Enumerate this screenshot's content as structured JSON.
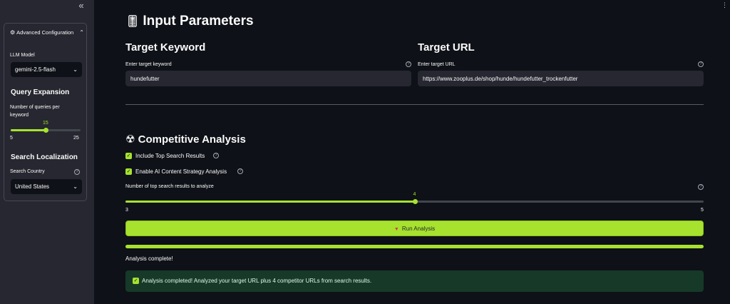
{
  "sidebar": {
    "collapse_icon": "double-chevron-left-icon",
    "config": {
      "title": "Advanced Configuration",
      "icon": "gear-icon",
      "llm_label": "LLM Model",
      "llm_value": "gemini-2.5-flash",
      "query_heading": "Query Expansion",
      "queries_label": "Number of queries per keyword",
      "queries_value": "15",
      "queries_min": "5",
      "queries_max": "25",
      "queries_fraction": 0.5,
      "loc_heading": "Search Localization",
      "country_label": "Search Country",
      "country_value": "United States"
    }
  },
  "main": {
    "menu_icon": "vertical-ellipsis-icon",
    "title": "Input Parameters",
    "title_icon": "sliders-icon",
    "keyword": {
      "heading": "Target Keyword",
      "label": "Enter target keyword",
      "value": "hundefutter"
    },
    "url": {
      "heading": "Target URL",
      "label": "Enter target URL",
      "value": "https://www.zooplus.de/shop/hunde/hundefutter_trockenfutter"
    },
    "analysis": {
      "heading": "Competitive Analysis",
      "icon": "radioactive-icon",
      "include_label": "Include Top Search Results",
      "enable_label": "Enable AI Content Strategy Analysis",
      "results_label": "Number of top search results to analyze",
      "results_value": "4",
      "results_min": "3",
      "results_max": "5",
      "results_fraction": 0.5
    },
    "run_label": "Run Analysis",
    "progress_fraction": 1.0,
    "status": "Analysis complete!",
    "success_message": "Analysis completed! Analyzed your target URL plus 4 competitor URLs from search results."
  },
  "colors": {
    "accent": "#a6e22e",
    "background": "#0e1117",
    "sidebar": "#262730",
    "success_bg": "#173928"
  }
}
